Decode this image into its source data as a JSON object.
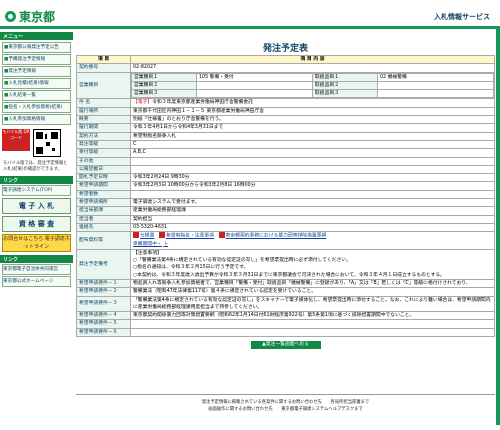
{
  "header": {
    "logo_text": "東京都",
    "service_title": "入札情報サービス"
  },
  "sidebar": {
    "menu_head": "メニュー",
    "items": [
      {
        "label": "東京都公報発注予定公告"
      },
      {
        "label": "予備発注予定情報"
      },
      {
        "label": "発注予定情報"
      },
      {
        "label": "入札見積(結果)情報"
      },
      {
        "label": "入札結果一覧"
      },
      {
        "label": "指名・入札参加資格(結果)"
      },
      {
        "label": "入札参加資格情報"
      }
    ],
    "mobile_btn": "モバイル版\nQRコード",
    "mobile_note": "モバイル版では、発注予定情報と入札(結果)の確認ができます。",
    "link_head": "リンク",
    "e_system": "電子調達システム(TOP)",
    "nyusatsu": "電 子 入 札",
    "shikaku": "資 格 審 査",
    "kaiho": "お問合せはこちら\n電子調達ホットライン",
    "links_head": "リンク",
    "links": [
      {
        "label": "東京都電子自治体共同運営"
      },
      {
        "label": "東京都公式ホームページ"
      }
    ]
  },
  "main": {
    "title": "発注予定表",
    "col_item": "項 目",
    "col_content": "項 目 内 容",
    "rows": [
      {
        "label": "契約番号",
        "value": "02-82027"
      },
      {
        "label": "営業種目",
        "value": ""
      },
      {
        "label": "件 名",
        "value": "令和３年度東京都産業労働局神田庁舎警備委託"
      },
      {
        "label": "履行場所",
        "value": "東京都千代田区内神田１－１－５ 東京都産業労働局神田庁舎"
      },
      {
        "label": "概要",
        "value": "別紙「仕様書」のとおり庁舎警備を行う。"
      },
      {
        "label": "履行期間",
        "value": "令和３年4月1日から令和4年3月31日まで"
      },
      {
        "label": "契約方法",
        "value": "希望制指名競争入札"
      },
      {
        "label": "発注等級",
        "value": "C"
      },
      {
        "label": "受付等級",
        "value": "A,B,C"
      },
      {
        "label": "その他",
        "value": ""
      },
      {
        "label": "公報登載日",
        "value": ""
      },
      {
        "label": "開札予定日時",
        "value": "令和3年2月24日 9時30分"
      },
      {
        "label": "希望申請期間",
        "value": "令和3年2月3日 10時00分から令和3年2月8日 16時00分"
      },
      {
        "label": "希望者数",
        "value": ""
      },
      {
        "label": "希望申請場所",
        "value": "電子調達システムで受付ます。"
      },
      {
        "label": "担当局部課",
        "value": "産業労働局総務部経理課"
      },
      {
        "label": "担当者",
        "value": "契約担当"
      },
      {
        "label": "連絡先",
        "value": "03-5320-4631"
      }
    ],
    "eigyo": [
      {
        "label": "営業種目１",
        "value": "105 警備・受付",
        "sub_label": "取扱品目１",
        "sub_value": "02 機械警備"
      },
      {
        "label": "営業種目２",
        "value": "",
        "sub_label": "取扱品目２",
        "sub_value": ""
      },
      {
        "label": "営業種目３",
        "value": "",
        "sub_label": "取扱品目３",
        "sub_value": ""
      }
    ],
    "kenmei_badge": "【電子】",
    "haifu_label": "配布資料等",
    "haifu_files": [
      "仕様書",
      "希望制指名・注意事項",
      "東京都契約事務における暴力団等排除措置要綱",
      "準備期間中・",
      "ト"
    ],
    "hattyu_biko_label": "発注予定備考",
    "biko_lines": [
      "【注意事項】",
      "○「警備業法第4条に規定されている有効な認定証の写し」を希望票提出時に必ず添付してください。",
      "○指名の通知は、令和３年２月15日に行う予定です。",
      "○本契約は、令和３年度歳入歳出予算が令和３年３月31日までに東京都議会で可決された場合において、令和３年４月１日成立するものとする。"
    ],
    "youken": [
      {
        "label": "希望申請要件－１",
        "value": "物品買入れ等競争入札参加資格者で、営業種目「警備・受付」取扱品目「機械警備」に登録があり、「A」又は「B」若しくは「C」等級に格付けされており、"
      },
      {
        "label": "希望申請要件－２",
        "value": "警備業法（昭和47年法律第117号）第４条に規定されている認定を受けていること。"
      },
      {
        "label": "希望申請要件－３",
        "value": "「警備業法第4条に規定されている有効な認定証の写し」をスキャナーで電子媒体化し、希望票提出時に添付すること。なお、これにより難い場合は、希望申請期間内に産業労働局総務部経理課用度担当まで持参してください。"
      },
      {
        "label": "希望申請要件－４",
        "value": "東京都契約関係暴力団等対策措置要綱（昭和62年1月14日付61財経庶第922号）第5条第1項に基づく排除措置期間中でないこと。"
      },
      {
        "label": "希望申請要件－５",
        "value": ""
      },
      {
        "label": "希望申請要件－６",
        "value": ""
      }
    ],
    "back_button": "▲発注一覧画面へ戻る"
  },
  "footer": {
    "line1": "発注予定情報に掲載されている各案件に関するお問い合わせ先　　各局所担当部署まで",
    "line2": "画面操作に関するお問い合わせ先　　東京都電子調達システムヘルプデスクまで"
  }
}
